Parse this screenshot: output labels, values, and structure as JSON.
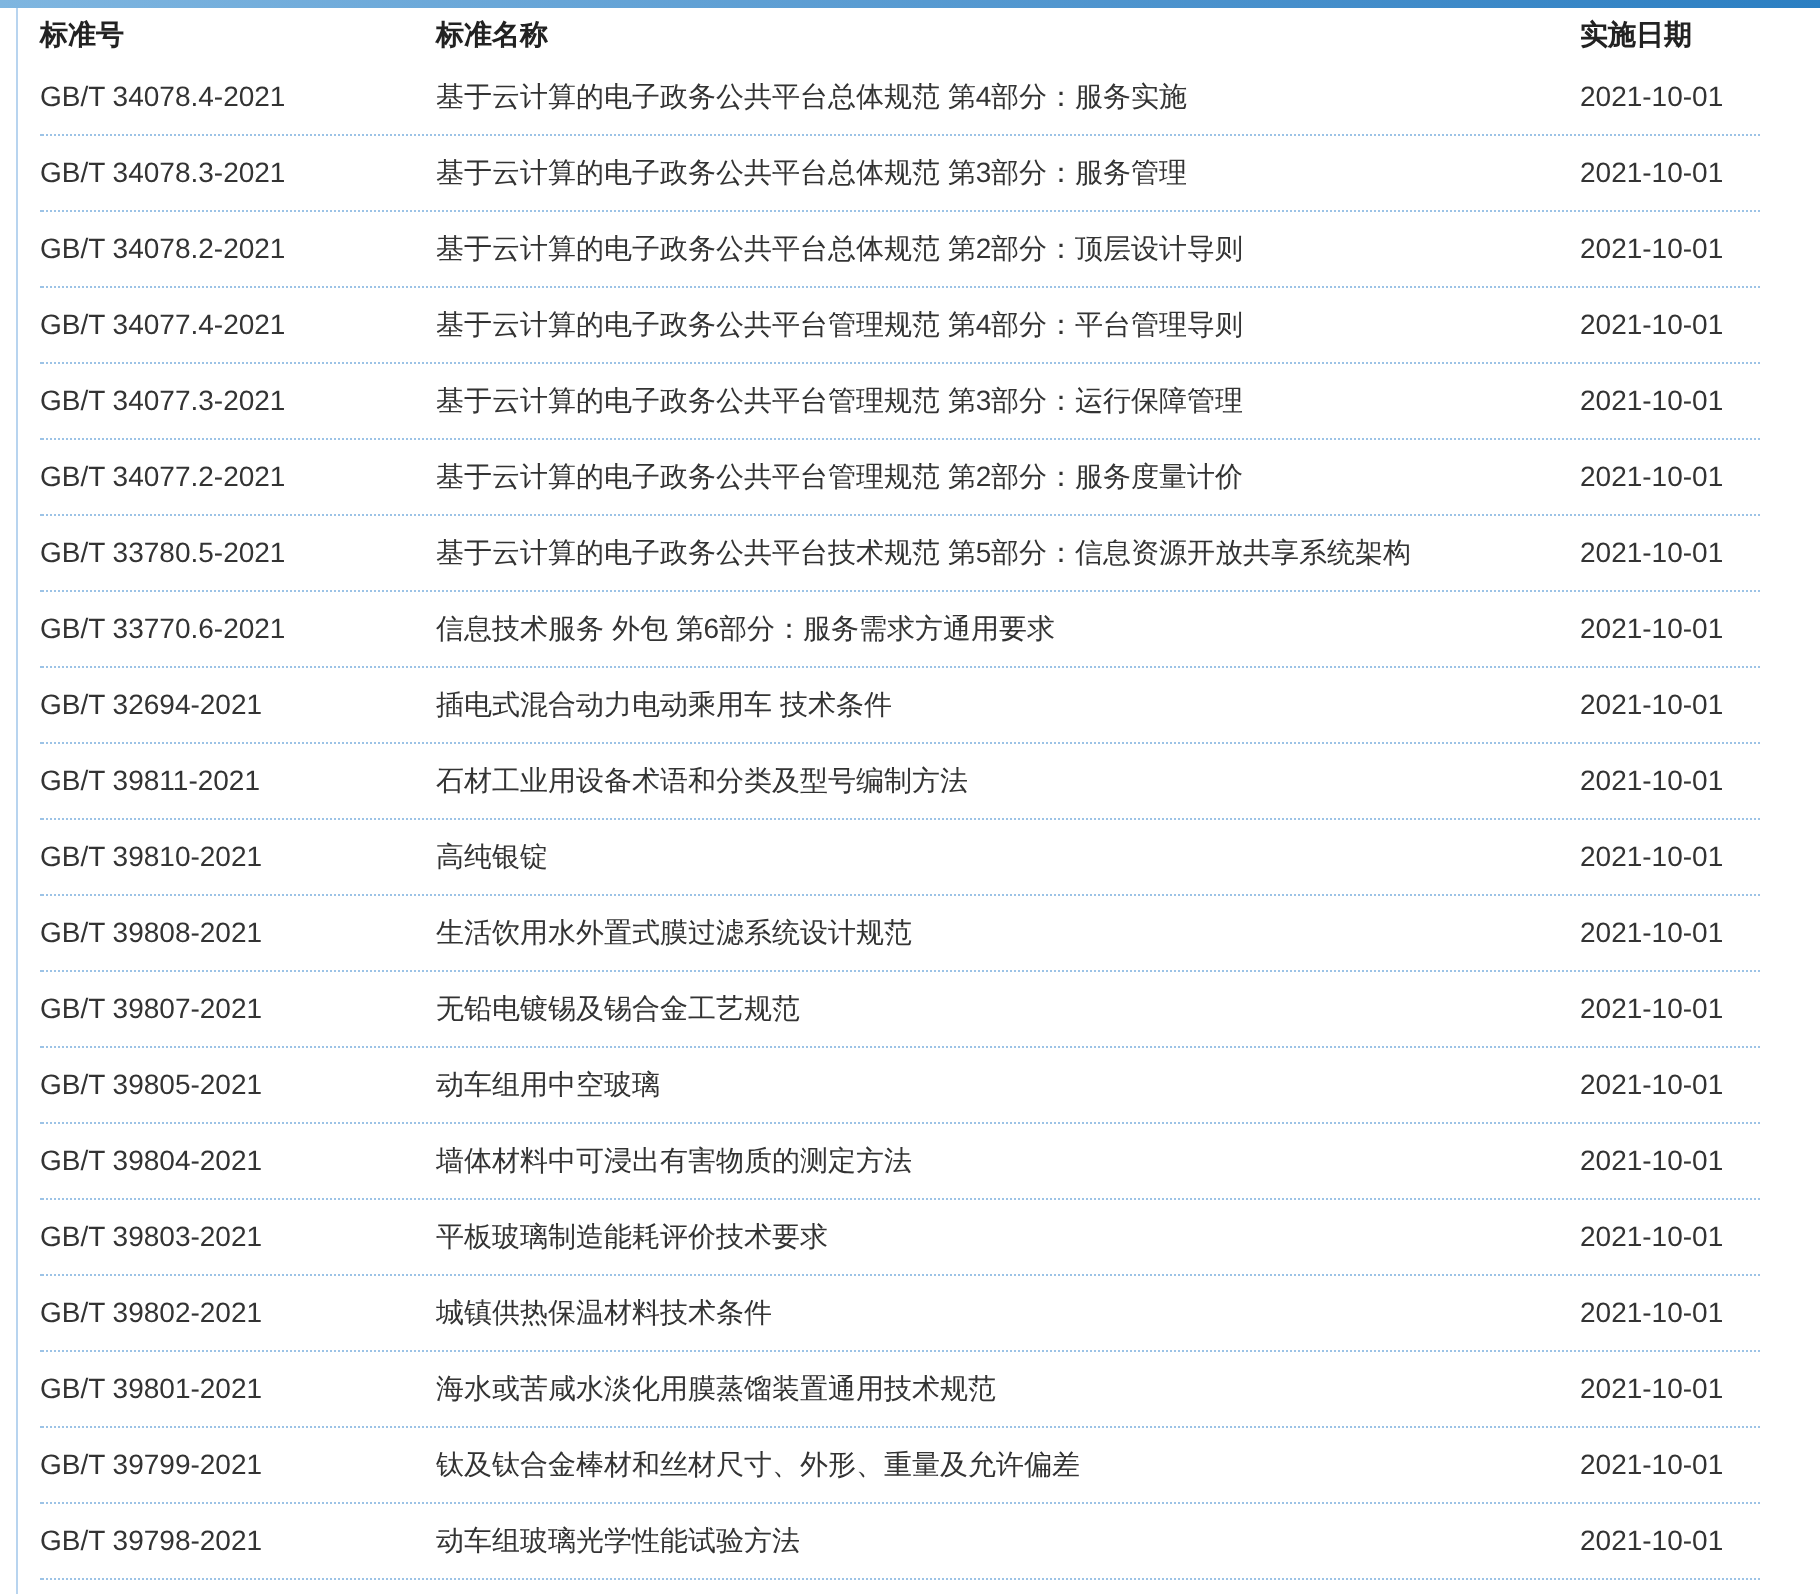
{
  "table": {
    "columns": [
      "标准号",
      "标准名称",
      "实施日期"
    ],
    "rows": [
      [
        "GB/T 34078.4-2021",
        "基于云计算的电子政务公共平台总体规范 第4部分：服务实施",
        "2021-10-01"
      ],
      [
        "GB/T 34078.3-2021",
        "基于云计算的电子政务公共平台总体规范 第3部分：服务管理",
        "2021-10-01"
      ],
      [
        "GB/T 34078.2-2021",
        "基于云计算的电子政务公共平台总体规范 第2部分：顶层设计导则",
        "2021-10-01"
      ],
      [
        "GB/T 34077.4-2021",
        "基于云计算的电子政务公共平台管理规范 第4部分：平台管理导则",
        "2021-10-01"
      ],
      [
        "GB/T 34077.3-2021",
        "基于云计算的电子政务公共平台管理规范 第3部分：运行保障管理",
        "2021-10-01"
      ],
      [
        "GB/T 34077.2-2021",
        "基于云计算的电子政务公共平台管理规范 第2部分：服务度量计价",
        "2021-10-01"
      ],
      [
        "GB/T 33780.5-2021",
        "基于云计算的电子政务公共平台技术规范 第5部分：信息资源开放共享系统架构",
        "2021-10-01"
      ],
      [
        "GB/T 33770.6-2021",
        "信息技术服务 外包 第6部分：服务需求方通用要求",
        "2021-10-01"
      ],
      [
        "GB/T 32694-2021",
        "插电式混合动力电动乘用车 技术条件",
        "2021-10-01"
      ],
      [
        "GB/T 39811-2021",
        "石材工业用设备术语和分类及型号编制方法",
        "2021-10-01"
      ],
      [
        "GB/T 39810-2021",
        "高纯银锭",
        "2021-10-01"
      ],
      [
        "GB/T 39808-2021",
        "生活饮用水外置式膜过滤系统设计规范",
        "2021-10-01"
      ],
      [
        "GB/T 39807-2021",
        "无铅电镀锡及锡合金工艺规范",
        "2021-10-01"
      ],
      [
        "GB/T 39805-2021",
        "动车组用中空玻璃",
        "2021-10-01"
      ],
      [
        "GB/T 39804-2021",
        "墙体材料中可浸出有害物质的测定方法",
        "2021-10-01"
      ],
      [
        "GB/T 39803-2021",
        "平板玻璃制造能耗评价技术要求",
        "2021-10-01"
      ],
      [
        "GB/T 39802-2021",
        "城镇供热保温材料技术条件",
        "2021-10-01"
      ],
      [
        "GB/T 39801-2021",
        "海水或苦咸水淡化用膜蒸馏装置通用技术规范",
        "2021-10-01"
      ],
      [
        "GB/T 39799-2021",
        "钛及钛合金棒材和丝材尺寸、外形、重量及允许偏差",
        "2021-10-01"
      ],
      [
        "GB/T 39798-2021",
        "动车组玻璃光学性能试验方法",
        "2021-10-01"
      ]
    ]
  }
}
